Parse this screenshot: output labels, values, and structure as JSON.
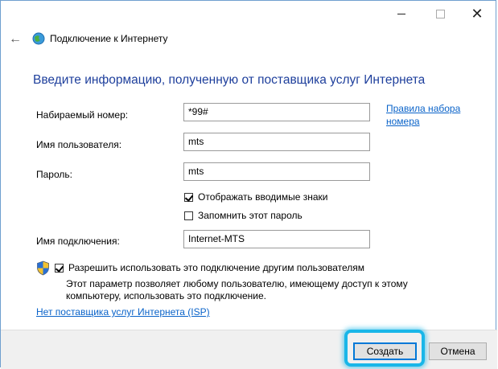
{
  "window": {
    "nav_title": "Подключение к Интернету",
    "heading": "Введите информацию, полученную от поставщика услуг Интернета"
  },
  "form": {
    "dial_number": {
      "label": "Набираемый номер:",
      "value": "*99#"
    },
    "dial_rules_link": {
      "line1": "Правила набора",
      "line2": "номера"
    },
    "username": {
      "label": "Имя пользователя:",
      "value": "mts"
    },
    "password": {
      "label": "Пароль:",
      "value": "mts"
    },
    "show_chars": {
      "label": "Отображать вводимые знаки",
      "checked": true
    },
    "remember_password": {
      "label": "Запомнить этот пароль",
      "checked": false
    },
    "connection_name": {
      "label": "Имя подключения:",
      "value": "Internet-MTS"
    },
    "allow_others": {
      "label": "Разрешить использовать это подключение другим пользователям",
      "checked": true
    },
    "allow_others_desc": "Этот параметр позволяет любому пользователю, имеющему доступ к этому компьютеру, использовать это подключение.",
    "no_isp_link": "Нет поставщика услуг Интернета (ISP)"
  },
  "buttons": {
    "create": "Создать",
    "cancel": "Отмена"
  },
  "colors": {
    "heading": "#1e3f9c",
    "link": "#0a63c9",
    "highlight": "#19b6e8"
  }
}
